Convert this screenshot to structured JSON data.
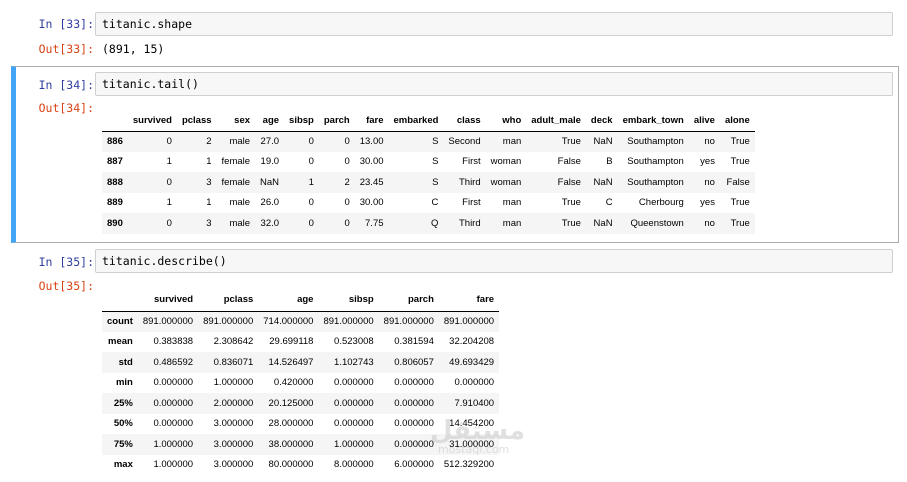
{
  "cells": {
    "c33": {
      "in_prompt": "In [33]:",
      "code": "titanic.shape",
      "out_prompt": "Out[33]:",
      "output": "(891, 15)"
    },
    "c34": {
      "in_prompt": "In [34]:",
      "code": "titanic.tail()",
      "out_prompt": "Out[34]:"
    },
    "c35": {
      "in_prompt": "In [35]:",
      "code": "titanic.describe()",
      "out_prompt": "Out[35]:"
    }
  },
  "tail_table": {
    "columns": [
      "",
      "survived",
      "pclass",
      "sex",
      "age",
      "sibsp",
      "parch",
      "fare",
      "embarked",
      "class",
      "who",
      "adult_male",
      "deck",
      "embark_town",
      "alive",
      "alone"
    ],
    "rows": [
      [
        "886",
        "0",
        "2",
        "male",
        "27.0",
        "0",
        "0",
        "13.00",
        "S",
        "Second",
        "man",
        "True",
        "NaN",
        "Southampton",
        "no",
        "True"
      ],
      [
        "887",
        "1",
        "1",
        "female",
        "19.0",
        "0",
        "0",
        "30.00",
        "S",
        "First",
        "woman",
        "False",
        "B",
        "Southampton",
        "yes",
        "True"
      ],
      [
        "888",
        "0",
        "3",
        "female",
        "NaN",
        "1",
        "2",
        "23.45",
        "S",
        "Third",
        "woman",
        "False",
        "NaN",
        "Southampton",
        "no",
        "False"
      ],
      [
        "889",
        "1",
        "1",
        "male",
        "26.0",
        "0",
        "0",
        "30.00",
        "C",
        "First",
        "man",
        "True",
        "C",
        "Cherbourg",
        "yes",
        "True"
      ],
      [
        "890",
        "0",
        "3",
        "male",
        "32.0",
        "0",
        "0",
        "7.75",
        "Q",
        "Third",
        "man",
        "True",
        "NaN",
        "Queenstown",
        "no",
        "True"
      ]
    ]
  },
  "describe_table": {
    "columns": [
      "",
      "survived",
      "pclass",
      "age",
      "sibsp",
      "parch",
      "fare"
    ],
    "rows": [
      [
        "count",
        "891.000000",
        "891.000000",
        "714.000000",
        "891.000000",
        "891.000000",
        "891.000000"
      ],
      [
        "mean",
        "0.383838",
        "2.308642",
        "29.699118",
        "0.523008",
        "0.381594",
        "32.204208"
      ],
      [
        "std",
        "0.486592",
        "0.836071",
        "14.526497",
        "1.102743",
        "0.806057",
        "49.693429"
      ],
      [
        "min",
        "0.000000",
        "1.000000",
        "0.420000",
        "0.000000",
        "0.000000",
        "0.000000"
      ],
      [
        "25%",
        "0.000000",
        "2.000000",
        "20.125000",
        "0.000000",
        "0.000000",
        "7.910400"
      ],
      [
        "50%",
        "0.000000",
        "3.000000",
        "28.000000",
        "0.000000",
        "0.000000",
        "14.454200"
      ],
      [
        "75%",
        "1.000000",
        "3.000000",
        "38.000000",
        "1.000000",
        "0.000000",
        "31.000000"
      ],
      [
        "max",
        "1.000000",
        "3.000000",
        "80.000000",
        "8.000000",
        "6.000000",
        "512.329200"
      ]
    ]
  },
  "watermark": {
    "main": "مستقل",
    "sub": "mostaql.com"
  },
  "colors": {
    "in_prompt": "#303f9f",
    "out_prompt": "#d84315",
    "selected_border": "#42a5f5"
  }
}
